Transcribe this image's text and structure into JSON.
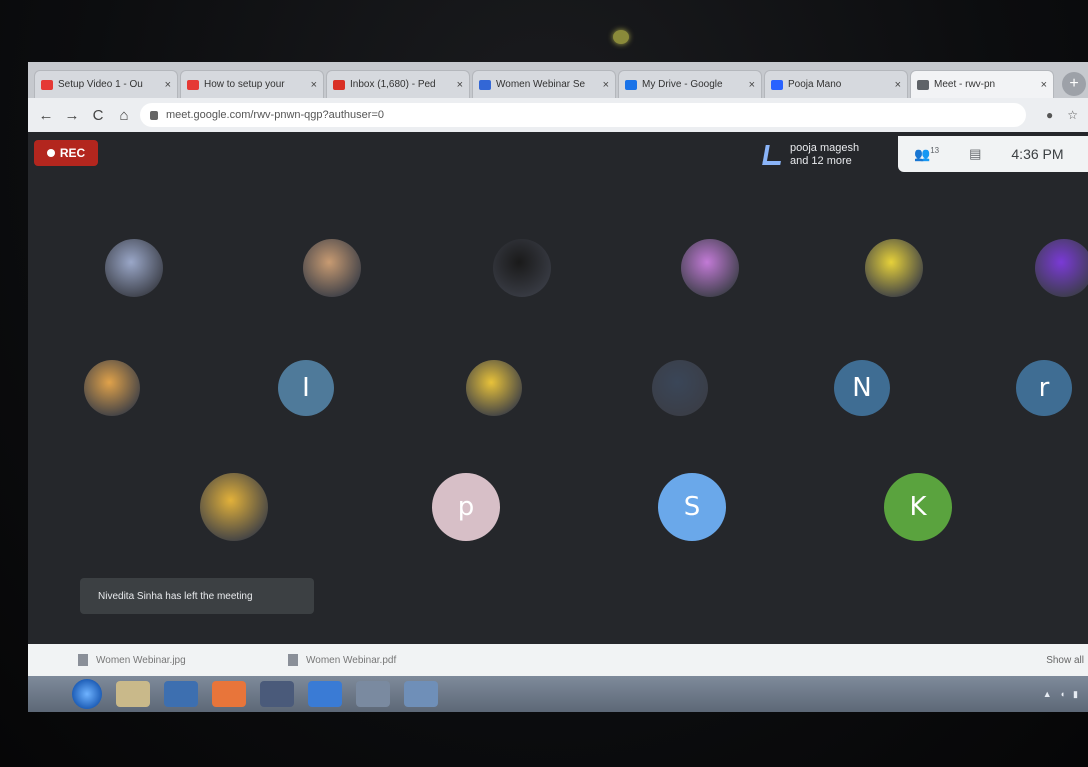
{
  "browser": {
    "tabs": [
      {
        "title": "Setup Video 1 - Ou",
        "favicon_color": "#e53935",
        "active": false
      },
      {
        "title": "How to setup your",
        "favicon_color": "#e53935",
        "active": false
      },
      {
        "title": "Inbox (1,680) - Ped",
        "favicon_color": "#d93025",
        "active": false
      },
      {
        "title": "Women Webinar Se",
        "favicon_color": "#3367d6",
        "active": false
      },
      {
        "title": "My Drive - Google",
        "favicon_color": "#1a73e8",
        "active": false
      },
      {
        "title": "Pooja Mano",
        "favicon_color": "#2962ff",
        "active": false
      },
      {
        "title": "Meet - rwv-pn",
        "favicon_color": "#5f6368",
        "active": true
      }
    ],
    "address": "meet.google.com/rwv-pnwn-qgp?authuser=0",
    "nav": {
      "back": "←",
      "forward": "→",
      "reload": "C",
      "home": "⌂"
    }
  },
  "meet": {
    "rec_label": "REC",
    "presenter_line1": "pooja magesh",
    "presenter_line2": "and 12 more",
    "participants_count": "13",
    "time": "4:36 PM",
    "toast": "Nivedita Sinha has left the meeting",
    "tiles_row1": [
      {
        "kind": "photo",
        "tint": "#9aa7c8"
      },
      {
        "kind": "photo",
        "tint": "#c89b72"
      },
      {
        "kind": "photo",
        "tint": "#1a1a1a"
      },
      {
        "kind": "photo",
        "tint": "#c27ad6"
      },
      {
        "kind": "photo",
        "tint": "#e6d13a"
      },
      {
        "kind": "photo",
        "tint": "#7a3ad6"
      }
    ],
    "tiles_row2": [
      {
        "kind": "photo",
        "tint": "#e0a24a"
      },
      {
        "kind": "letter",
        "letter": "I",
        "color": "#4f7a9a"
      },
      {
        "kind": "photo",
        "tint": "#e8c23a"
      },
      {
        "kind": "photo",
        "tint": "#3a4658"
      },
      {
        "kind": "letter",
        "letter": "N",
        "color": "#3f6d93"
      },
      {
        "kind": "letter",
        "letter": "r",
        "color": "#3f6d93"
      }
    ],
    "tiles_row3": [
      {
        "kind": "photo",
        "tint": "#e2b13a"
      },
      {
        "kind": "letter",
        "letter": "p",
        "color": "#d7bfc7"
      },
      {
        "kind": "letter",
        "letter": "S",
        "color": "#6aa8ea"
      },
      {
        "kind": "letter",
        "letter": "K",
        "color": "#5aa33e"
      }
    ]
  },
  "downloads": {
    "items": [
      "Women Webinar.jpg",
      "Women Webinar.pdf"
    ],
    "show_all": "Show all"
  }
}
